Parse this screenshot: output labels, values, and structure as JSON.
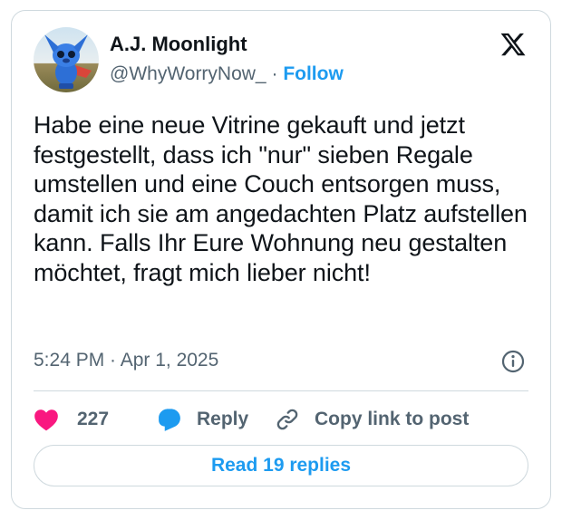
{
  "author": {
    "name": "A.J. Moonlight",
    "handle": "@WhyWorryNow_",
    "separator": "·",
    "follow_label": "Follow",
    "avatar_icon": "blue-creature-figurine-avatar"
  },
  "tweet": {
    "text": "Habe eine neue Vitrine gekauft und jetzt festgestellt, dass ich \"nur\" sieben Regale umstellen und eine Couch entsorgen muss, damit ich sie am angedachten Platz aufstellen kann. Falls Ihr Eure Wohnung neu gestalten möchtet, fragt mich lieber nicht!",
    "timestamp": "5:24 PM · Apr 1, 2025"
  },
  "actions": {
    "like_count": "227",
    "reply_label": "Reply",
    "copy_link_label": "Copy link to post"
  },
  "read_replies_label": "Read 19 replies",
  "colors": {
    "accent": "#1d9bf0",
    "heart": "#f91880",
    "text_primary": "#0f1419",
    "text_secondary": "#536471",
    "border": "#cfd9de"
  },
  "icons": [
    "x-logo-icon",
    "info-icon",
    "heart-icon",
    "reply-bubble-icon",
    "link-icon"
  ]
}
